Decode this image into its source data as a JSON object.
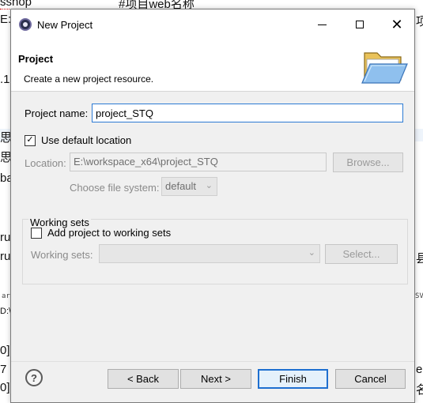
{
  "background": {
    "frag_top_left": "sshop",
    "frag_top_center": "#项目web名称",
    "frag_left_1": "E:",
    "frag_right_1": "项",
    "frag_left_2": ".1",
    "frag_left_3": "思",
    "frag_left_4": "思",
    "frag_left_5": "ba",
    "frag_left_6": "ru",
    "frag_left_7": "ru",
    "frag_right_7": "县",
    "frag_mono_1": "ar",
    "frag_mono_right": "SV",
    "frag_left_8": "D:\\(",
    "frag_left_9": "0]",
    "frag_left_10": "7",
    "frag_right_10": "e",
    "frag_left_11": "0]",
    "frag_right_11": "名"
  },
  "dialog": {
    "title": "New Project",
    "controls": {
      "minimize": "minimize",
      "maximize": "maximize",
      "close": "✕"
    }
  },
  "banner": {
    "title": "Project",
    "description": "Create a new project resource.",
    "icon": "folder-icon"
  },
  "form": {
    "project_name_label": "Project name:",
    "project_name_value": "project_STQ",
    "use_default_location_label": "Use default location",
    "use_default_location_checked": true,
    "location_label": "Location:",
    "location_value": "E:\\workspace_x64\\project_STQ",
    "browse_label": "Browse...",
    "file_system_label": "Choose file system:",
    "file_system_value": "default"
  },
  "working_sets": {
    "group_title": "Working sets",
    "add_label": "Add project to working sets",
    "add_checked": false,
    "sets_label": "Working sets:",
    "sets_value": "",
    "select_label": "Select..."
  },
  "footer": {
    "help_icon": "help-icon",
    "back_label": "< Back",
    "next_label": "Next >",
    "finish_label": "Finish",
    "cancel_label": "Cancel"
  }
}
